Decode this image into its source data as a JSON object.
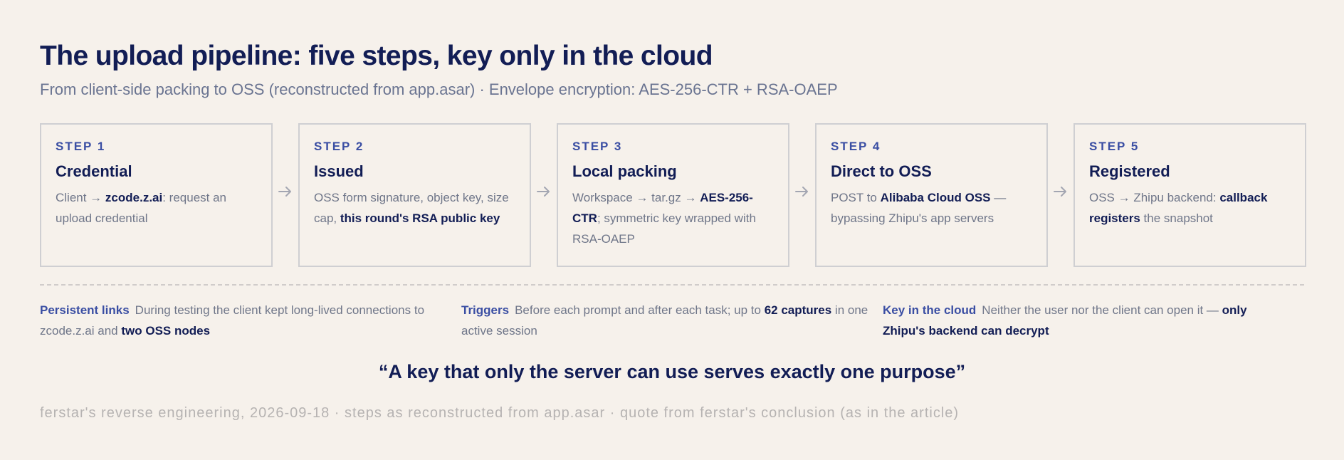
{
  "title": "The upload pipeline: five steps, key only in the cloud",
  "subtitle": "From client-side packing to OSS (reconstructed from app.asar) · Envelope encryption: AES-256-CTR + RSA-OAEP",
  "steps": [
    {
      "num": "STEP 1",
      "title": "Credential",
      "body": [
        {
          "t": "Client → ",
          "b": false
        },
        {
          "t": "zcode.z.ai",
          "b": true
        },
        {
          "t": ": request an upload credential",
          "b": false
        }
      ]
    },
    {
      "num": "STEP 2",
      "title": "Issued",
      "body": [
        {
          "t": "OSS form signature, object key, size cap, ",
          "b": false
        },
        {
          "t": "this round's RSA public key",
          "b": true
        }
      ]
    },
    {
      "num": "STEP 3",
      "title": "Local packing",
      "body": [
        {
          "t": "Workspace → tar.gz → ",
          "b": false
        },
        {
          "t": "AES-256-CTR",
          "b": true
        },
        {
          "t": "; symmetric key wrapped with RSA-OAEP",
          "b": false
        }
      ]
    },
    {
      "num": "STEP 4",
      "title": "Direct to OSS",
      "body": [
        {
          "t": "POST to ",
          "b": false
        },
        {
          "t": "Alibaba Cloud OSS",
          "b": true
        },
        {
          "t": " — bypassing Zhipu's app servers",
          "b": false
        }
      ]
    },
    {
      "num": "STEP 5",
      "title": "Registered",
      "body": [
        {
          "t": "OSS → Zhipu backend: ",
          "b": false
        },
        {
          "t": "callback registers",
          "b": true
        },
        {
          "t": " the snapshot",
          "b": false
        }
      ]
    }
  ],
  "notes": [
    {
      "label": "Persistent links",
      "body": [
        {
          "t": "During testing the client kept long-lived connections to zcode.z.ai and ",
          "b": false
        },
        {
          "t": "two OSS nodes",
          "b": true
        }
      ]
    },
    {
      "label": "Triggers",
      "body": [
        {
          "t": "Before each prompt and after each task; up to ",
          "b": false
        },
        {
          "t": "62 captures",
          "b": true
        },
        {
          "t": " in one active session",
          "b": false
        }
      ]
    },
    {
      "label": "Key in the cloud",
      "body": [
        {
          "t": "Neither the user nor the client can open it — ",
          "b": false
        },
        {
          "t": "only Zhipu's backend can decrypt",
          "b": true
        }
      ]
    }
  ],
  "quote": "“A key that only the server can use serves exactly one purpose”",
  "footer": "ferstar's reverse engineering, 2026-09-18 · steps as reconstructed from app.asar · quote from ferstar's conclusion (as in the article)",
  "icons": {
    "arrow": "arrow-right-icon"
  },
  "colors": {
    "background": "#f6f1eb",
    "accent": "#3a4ea3",
    "heading": "#121d55",
    "muted": "#6f7689"
  }
}
